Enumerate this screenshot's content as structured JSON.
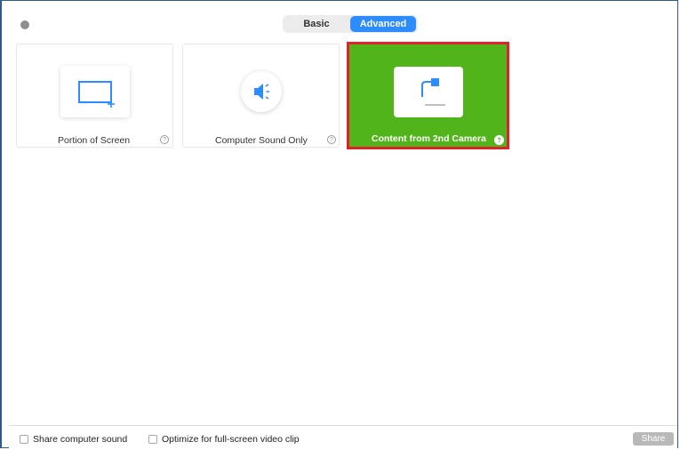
{
  "tabs": {
    "basic_label": "Basic",
    "advanced_label": "Advanced",
    "selected": "Advanced"
  },
  "options": [
    {
      "label": "Portion of Screen",
      "icon": "portion-of-screen-icon",
      "help": "?"
    },
    {
      "label": "Computer Sound Only",
      "icon": "speaker-icon",
      "help": "?"
    },
    {
      "label": "Content from 2nd Camera",
      "icon": "camera-icon",
      "help": "?",
      "selected": true
    }
  ],
  "footer": {
    "share_sound_label": "Share computer sound",
    "optimize_label": "Optimize for full-screen video clip",
    "share_button_label": "Share"
  },
  "colors": {
    "accent_blue": "#2d8cff",
    "selected_green": "#52b41b",
    "highlight_red": "#e0232a"
  }
}
